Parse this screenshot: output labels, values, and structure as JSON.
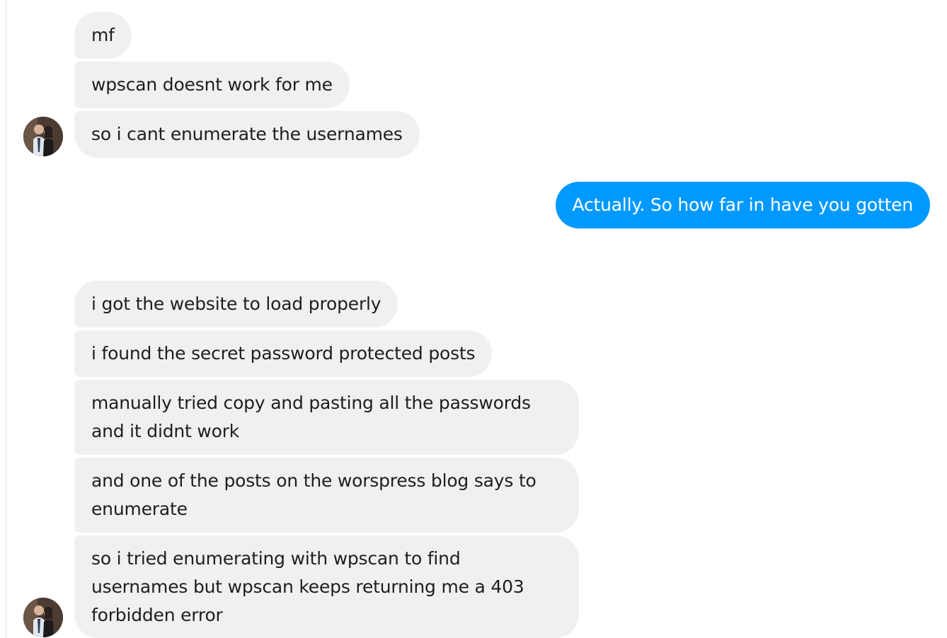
{
  "conversation": {
    "group1": {
      "messages": [
        "mf",
        "wpscan doesnt work for me",
        "so i cant enumerate the usernames"
      ]
    },
    "outgoing": {
      "message": "Actually. So how far in have you gotten"
    },
    "group2": {
      "messages": [
        "i got the website to load properly",
        "i found the secret password protected posts",
        "manually tried copy and pasting all the passwords and it didnt work",
        "and one of the posts on the worspress blog says to enumerate",
        "so i tried enumerating with wpscan to find usernames but wpscan keeps returning me a 403 forbidden error"
      ]
    }
  },
  "colors": {
    "incoming_bubble": "#f0f0f0",
    "outgoing_bubble": "#0099ff",
    "text": "#1c1e21"
  },
  "icons": {
    "avatar": "contact-avatar-photo"
  }
}
